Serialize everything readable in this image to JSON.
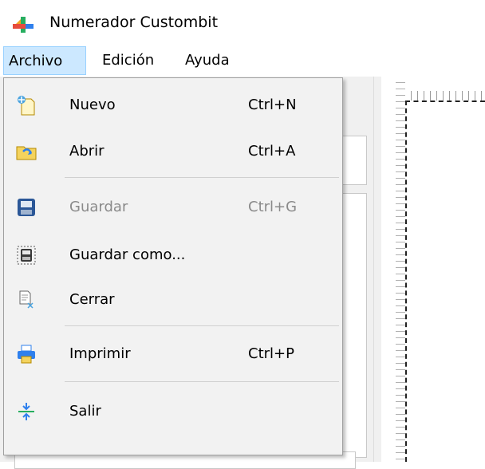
{
  "window": {
    "title": "Numerador Custombit",
    "logo_icon": "app-logo-icon"
  },
  "menubar": {
    "items": [
      {
        "label": "Archivo",
        "active": true
      },
      {
        "label": "Edición",
        "active": false
      },
      {
        "label": "Ayuda",
        "active": false
      }
    ]
  },
  "archivo_menu": {
    "items": [
      {
        "label": "Nuevo",
        "shortcut": "Ctrl+N",
        "icon": "new-file-icon",
        "enabled": true
      },
      {
        "label": "Abrir",
        "shortcut": "Ctrl+A",
        "icon": "open-folder-icon",
        "enabled": true
      },
      {
        "label": "Guardar",
        "shortcut": "Ctrl+G",
        "icon": "save-icon",
        "enabled": false
      },
      {
        "label": "Guardar como...",
        "shortcut": "",
        "icon": "save-as-icon",
        "enabled": true
      },
      {
        "label": "Cerrar",
        "shortcut": "",
        "icon": "close-document-icon",
        "enabled": true
      },
      {
        "label": "Imprimir",
        "shortcut": "Ctrl+P",
        "icon": "printer-icon",
        "enabled": true
      },
      {
        "label": "Salir",
        "shortcut": "",
        "icon": "exit-icon",
        "enabled": true
      }
    ]
  },
  "colors": {
    "menu_active_bg": "#cce8ff",
    "menu_active_border": "#99d1ff",
    "disabled_text": "#8a8a8a"
  }
}
